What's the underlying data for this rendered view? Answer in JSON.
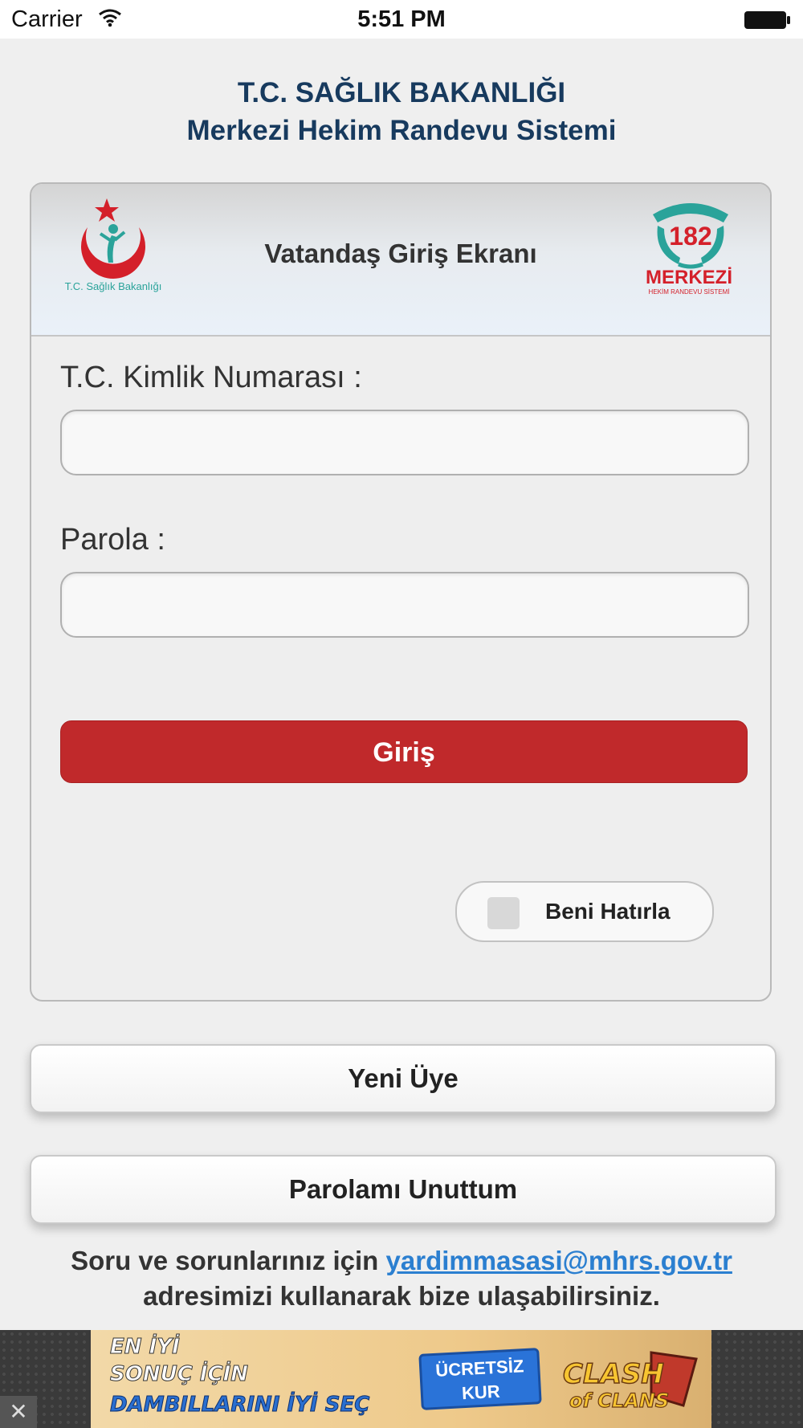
{
  "status_bar": {
    "carrier": "Carrier",
    "time": "5:51 PM"
  },
  "header": {
    "line1": "T.C. SAĞLIK BAKANLIĞI",
    "line2": "Merkezi Hekim Randevu Sistemi"
  },
  "login_card": {
    "title": "Vatandaş Giriş Ekranı",
    "left_logo_text": "T.C. Sağlık Bakanlığı",
    "right_logo": {
      "number": "182",
      "name": "MERKEZİ",
      "subtitle": "HEKİM RANDEVU SİSTEMİ"
    },
    "tc_label": "T.C. Kimlik Numarası :",
    "tc_value": "",
    "password_label": "Parola :",
    "password_value": "",
    "login_button": "Giriş",
    "remember_label": "Beni Hatırla",
    "remember_checked": false
  },
  "actions": {
    "new_member": "Yeni Üye",
    "forgot_password": "Parolamı Unuttum"
  },
  "contact": {
    "prefix": "Soru ve sorunlarınız için",
    "email": "yardimmasasi@mhrs.gov.tr",
    "suffix": "adresimizi kullanarak bize ulaşabilirsiniz."
  },
  "ad": {
    "line1": "EN İYİ",
    "line2": "SONUÇ İÇİN",
    "line3": "DAMBILLARINI İYİ SEÇ",
    "cta_line1": "ÜCRETSİZ",
    "cta_line2": "KUR",
    "game_line1": "CLASH",
    "game_line2": "of CLANS",
    "close": "✕"
  },
  "colors": {
    "primary_red": "#c0292b",
    "header_navy": "#173a5e",
    "link_blue": "#2b7fd0",
    "logo_teal": "#2aa39a"
  }
}
